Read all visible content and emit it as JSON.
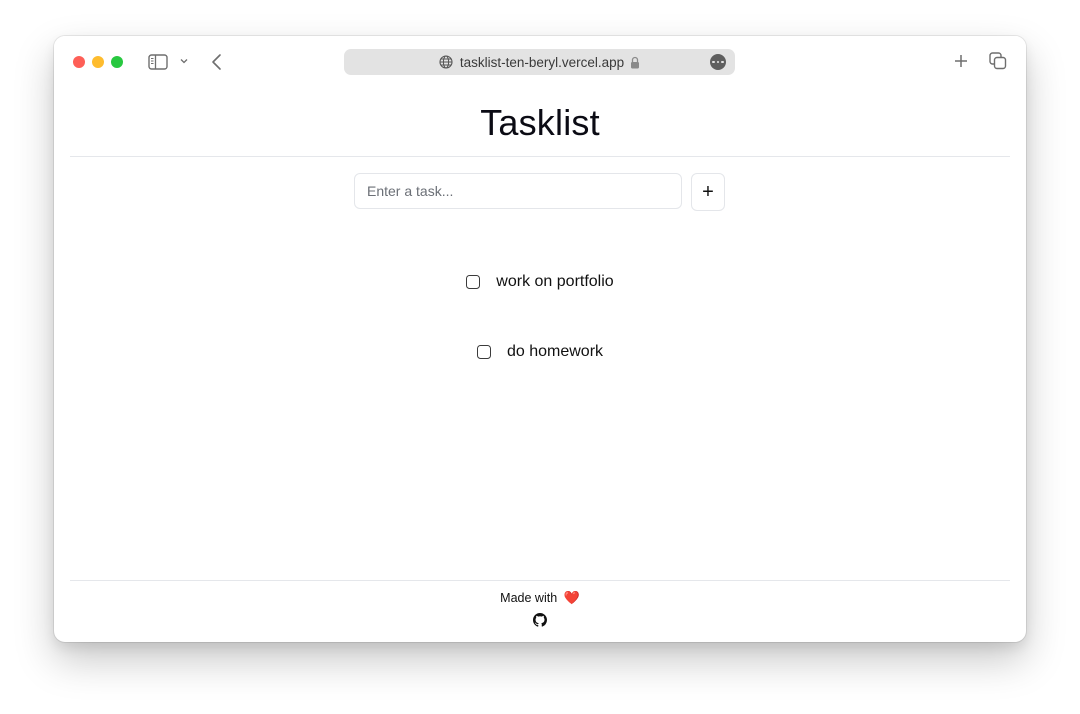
{
  "browser": {
    "url": "tasklist-ten-beryl.vercel.app",
    "icons": {
      "sidebar": "sidebar-icon",
      "chevron": "chevron-down-icon",
      "back": "back-icon",
      "globe": "globe-icon",
      "lock": "lock-icon",
      "more": "more-icon",
      "new_tab": "plus-icon",
      "tabs": "tabs-overview-icon"
    },
    "traffic_lights": {
      "close": "#fe5f57",
      "minimize": "#febc2e",
      "maximize": "#28c840"
    }
  },
  "page": {
    "title": "Tasklist",
    "input": {
      "placeholder": "Enter a task...",
      "value": ""
    },
    "add_button_label": "+",
    "tasks": [
      {
        "label": "work on portfolio",
        "checked": false
      },
      {
        "label": "do homework",
        "checked": false
      }
    ],
    "footer": {
      "made_with": "Made with",
      "heart": "❤️",
      "github_icon": "github-icon"
    }
  }
}
